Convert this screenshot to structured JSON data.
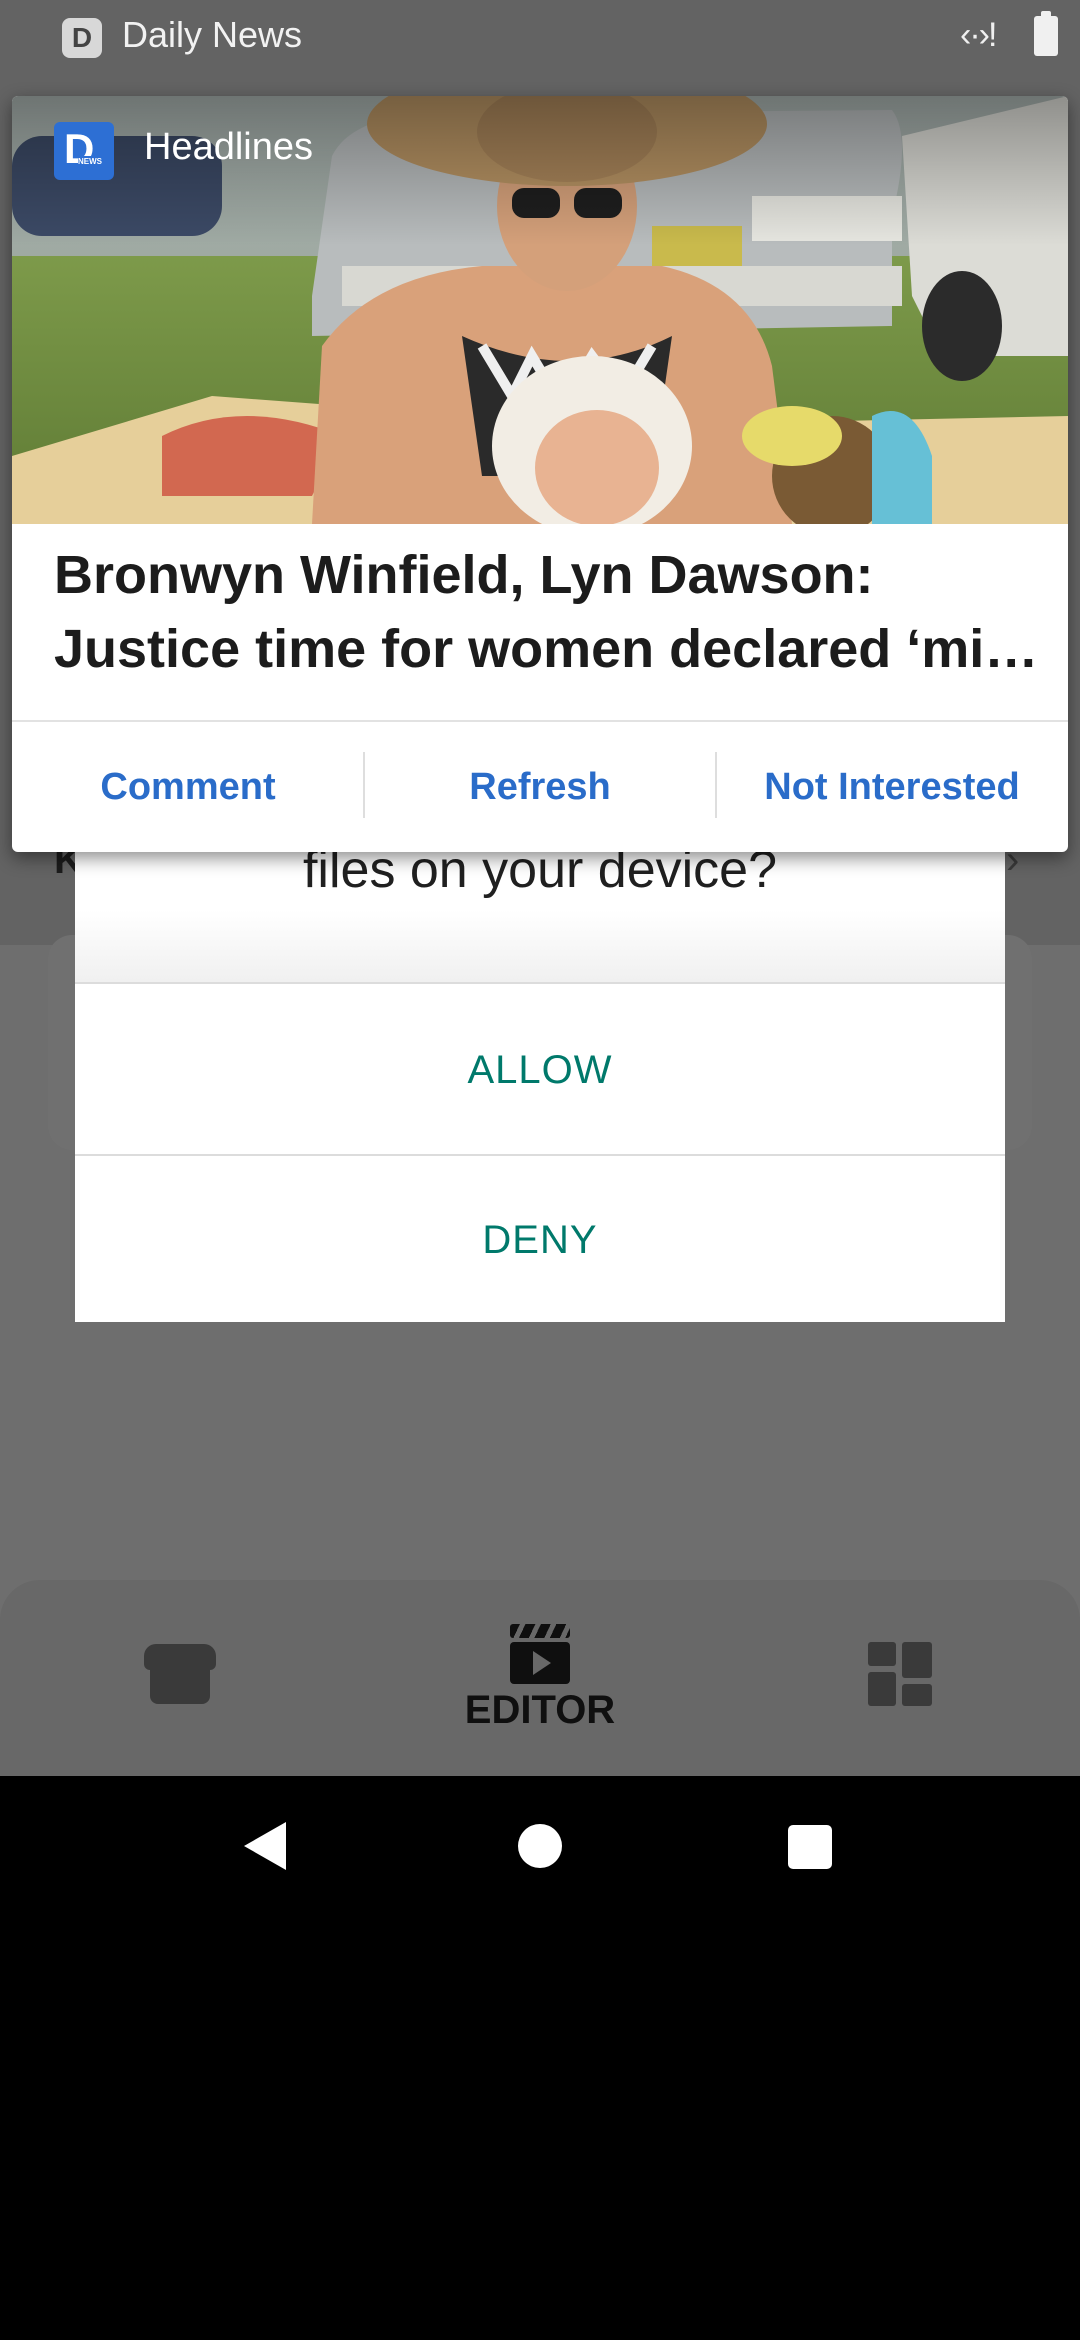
{
  "status_bar": {
    "app_name": "Daily News",
    "app_icon": "news-icon",
    "data_icon": "data-transfer-icon",
    "battery_icon": "battery-icon"
  },
  "notification": {
    "app_icon": "daily-news-logo-icon",
    "channel": "Headlines",
    "title_line1": "Bronwyn Winfield, Lyn Dawson:",
    "title_line2": "Justice time for women declared ‘mi…",
    "actions": {
      "comment": "Comment",
      "refresh": "Refresh",
      "not_interested": "Not Interested"
    },
    "accent_color": "#2a6cc9"
  },
  "permission_dialog": {
    "question_fragment": "files on your device?",
    "allow_label": "ALLOW",
    "deny_label": "DENY",
    "button_color": "#00796b"
  },
  "background_app": {
    "row_letter": "K",
    "row_chevron": "›",
    "bottom_nav": {
      "store_icon": "store-icon",
      "editor_label": "EDITOR",
      "editor_icon": "clapperboard-play-icon",
      "dashboard_icon": "dashboard-icon"
    }
  },
  "system_nav": {
    "back": "back-icon",
    "home": "home-icon",
    "recents": "recents-icon"
  }
}
